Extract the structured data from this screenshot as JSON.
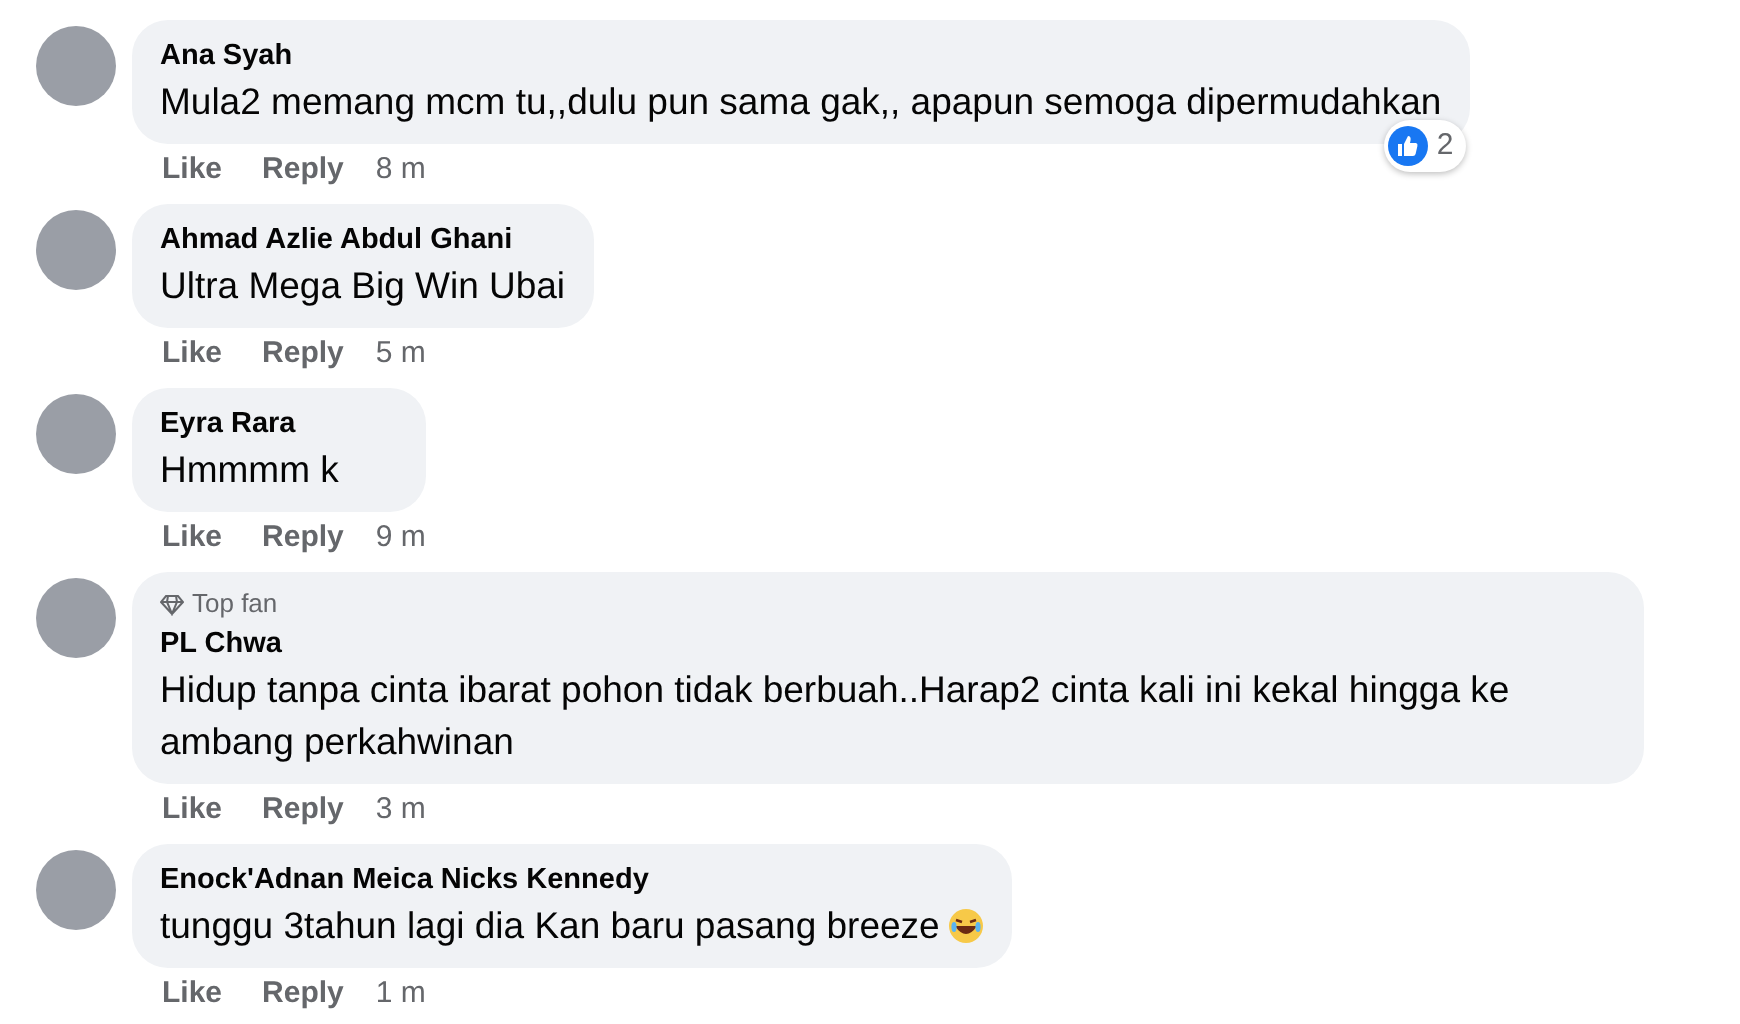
{
  "comments": [
    {
      "author": "Ana Syah",
      "text": "Mula2 memang mcm tu,,dulu pun sama gak,, apapun semoga dipermudahkan",
      "actions": [
        "Like",
        "Reply"
      ],
      "time": "8 m",
      "reactions": {
        "count": "2"
      }
    },
    {
      "author": "Ahmad Azlie Abdul Ghani",
      "text": "Ultra Mega Big Win Ubai",
      "actions": [
        "Like",
        "Reply"
      ],
      "time": "5 m"
    },
    {
      "author": "Eyra Rara",
      "text": "Hmmmm k",
      "actions": [
        "Like",
        "Reply"
      ],
      "time": "9 m"
    },
    {
      "badge": "Top fan",
      "author": "PL Chwa",
      "text": "Hidup tanpa cinta ibarat pohon tidak berbuah..Harap2 cinta kali ini kekal hingga ke ambang perkahwinan",
      "actions": [
        "Like",
        "Reply"
      ],
      "time": "3 m"
    },
    {
      "author": "Enock'Adnan Meica Nicks Kennedy",
      "text": "tunggu 3tahun lagi dia Kan baru pasang breeze",
      "trailing_emoji": true,
      "actions": [
        "Like",
        "Reply"
      ],
      "time": "1 m"
    }
  ]
}
